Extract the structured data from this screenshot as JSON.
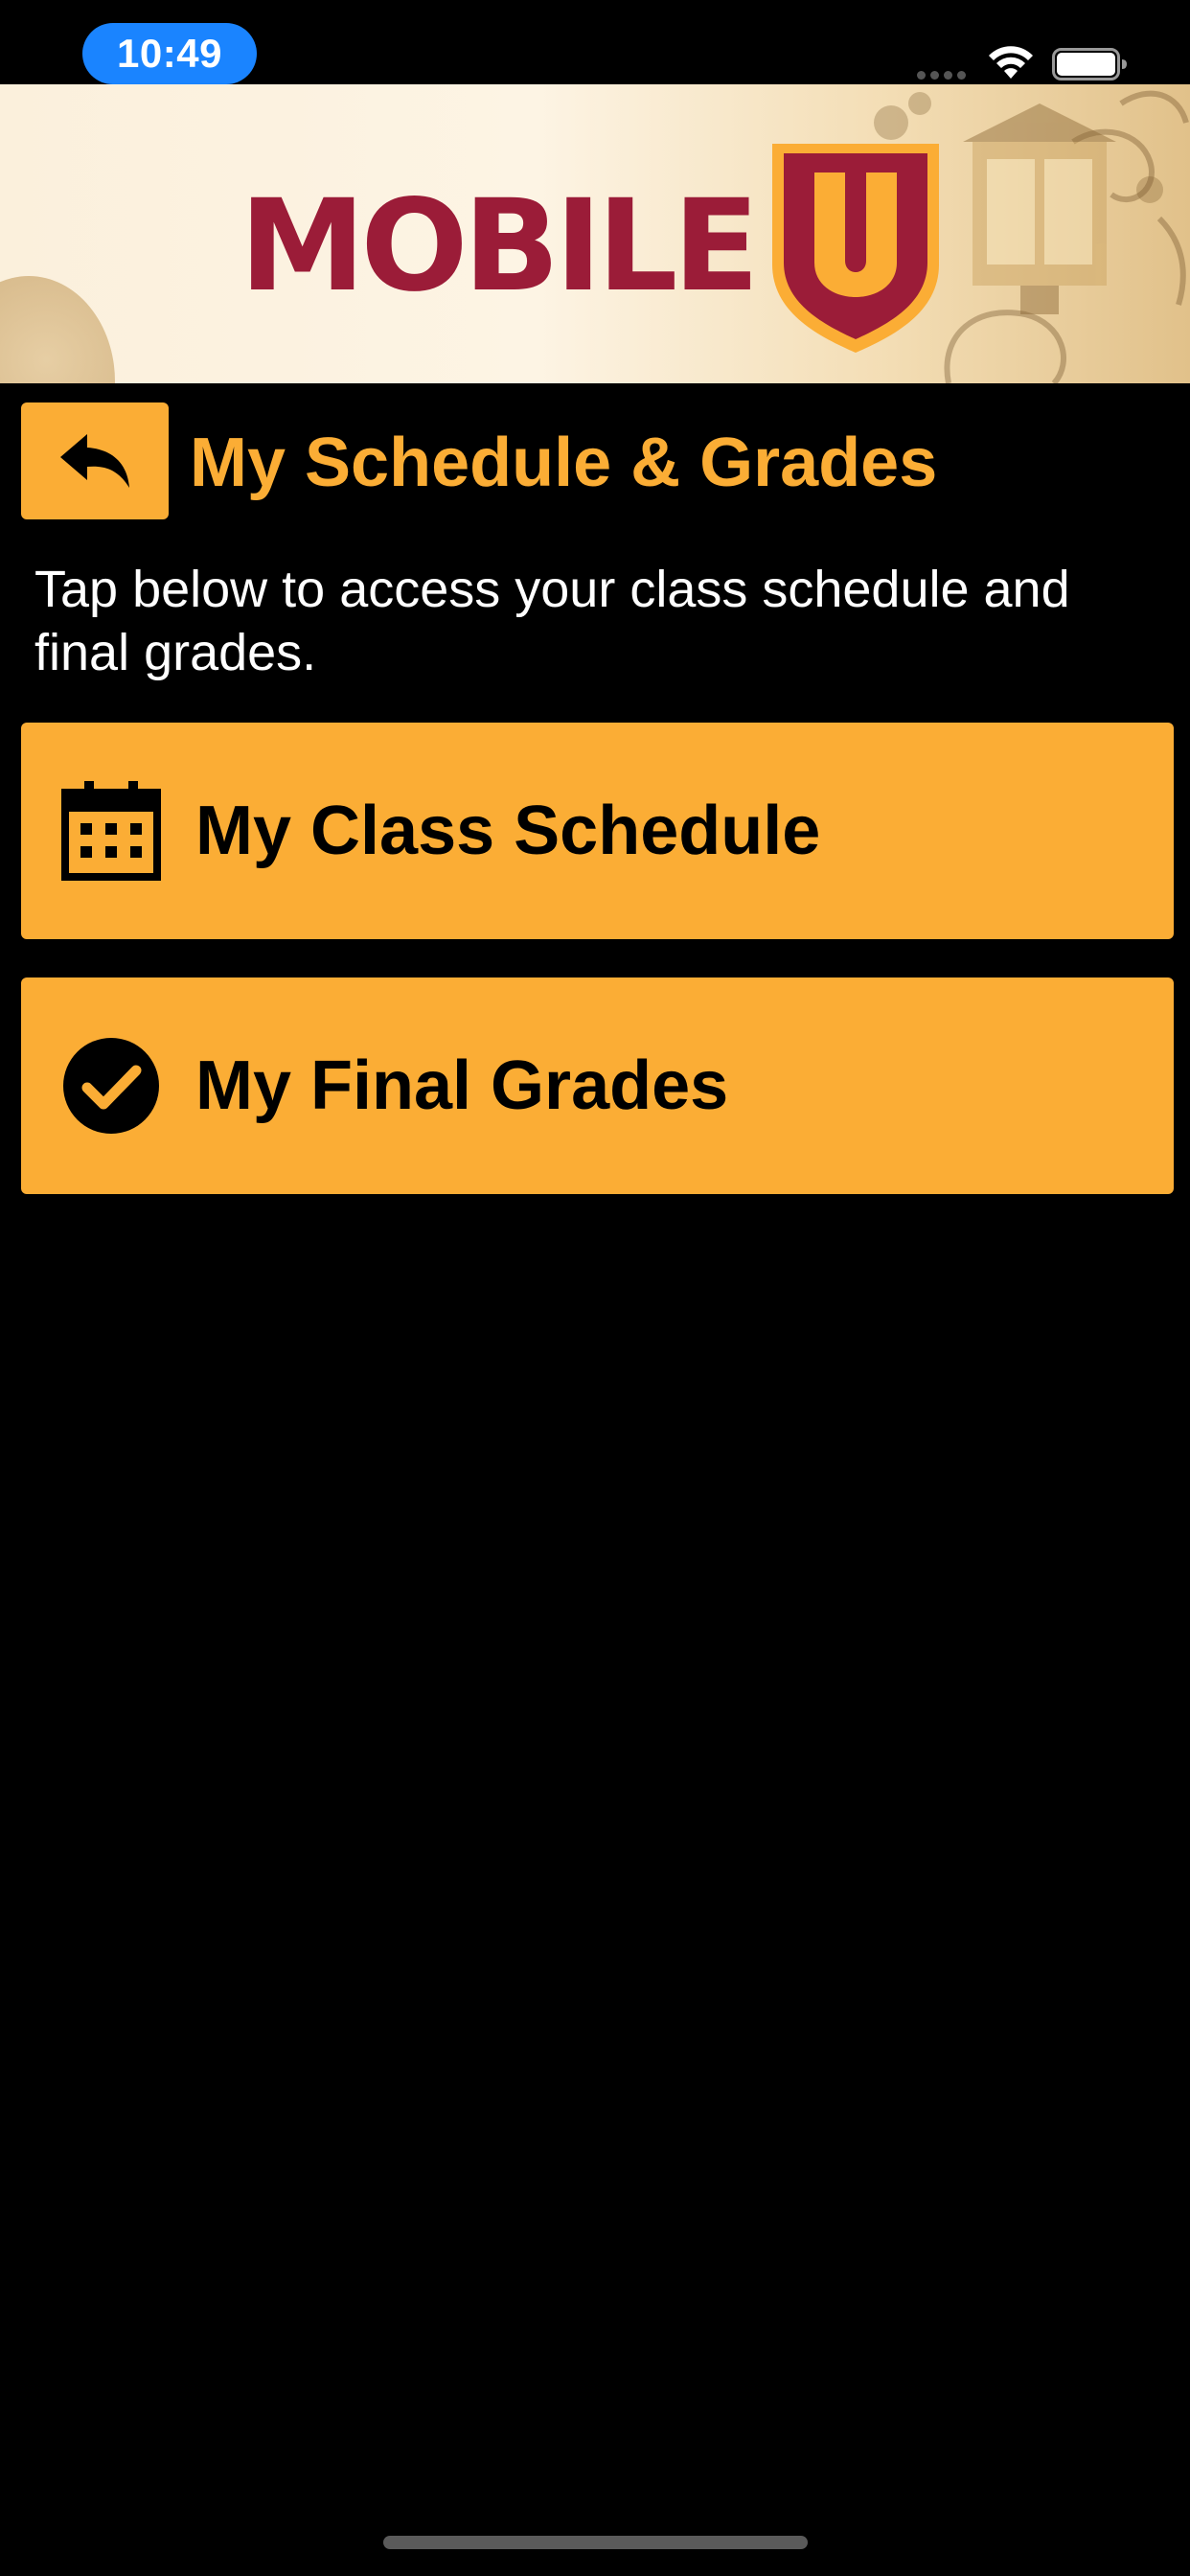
{
  "status_bar": {
    "time": "10:49",
    "icons": [
      "signal-dots-icon",
      "wifi-icon",
      "battery-icon"
    ]
  },
  "banner": {
    "logo_text": "MOBILE",
    "logo_shield_letter": "U",
    "colors": {
      "logo_red": "#9b1c38",
      "shield_gold": "#fbad35"
    }
  },
  "header": {
    "back_icon": "reply-arrow-icon",
    "title": "My Schedule & Grades"
  },
  "description": "Tap below to access your class schedule and final grades.",
  "menu": [
    {
      "label": "My Class Schedule",
      "icon": "calendar-icon"
    },
    {
      "label": "My Final Grades",
      "icon": "check-circle-icon"
    }
  ],
  "theme": {
    "background": "#000000",
    "accent": "#fbad35",
    "text": "#ffffff",
    "button_text": "#000000"
  }
}
